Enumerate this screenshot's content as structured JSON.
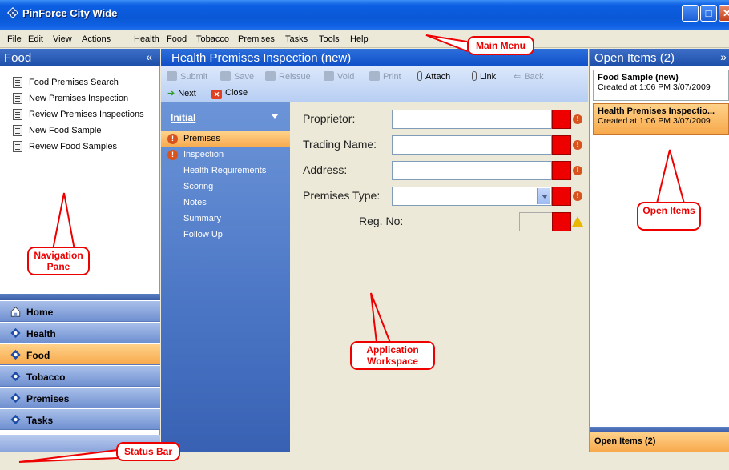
{
  "window": {
    "title": "PinForce City Wide"
  },
  "menu": {
    "items": [
      "File",
      "Edit",
      "View",
      "Actions",
      "Health",
      "Food",
      "Tobacco",
      "Premises",
      "Tasks",
      "Tools",
      "Help"
    ]
  },
  "nav_pane": {
    "title": "Food",
    "links": [
      "Food Premises Search",
      "New Premises Inspection",
      "Review Premises Inspections",
      "New Food Sample",
      "Review Food Samples"
    ],
    "buttons": [
      "Home",
      "Health",
      "Food",
      "Tobacco",
      "Premises",
      "Tasks"
    ],
    "active_button": "Food"
  },
  "workspace": {
    "title": "Health Premises Inspection (new)",
    "toolbar": {
      "submit": "Submit",
      "save": "Save",
      "reissue": "Reissue",
      "void": "Void",
      "print": "Print",
      "attach": "Attach",
      "link": "Link",
      "back": "Back",
      "next": "Next",
      "close": "Close"
    },
    "steps_header": "Initial",
    "steps": [
      "Premises",
      "Inspection",
      "Health Requirements",
      "Scoring",
      "Notes",
      "Summary",
      "Follow Up"
    ],
    "active_step": "Premises",
    "form": {
      "proprietor_label": "Proprietor:",
      "trading_name_label": "Trading Name:",
      "address_label": "Address:",
      "premises_type_label": "Premises Type:",
      "reg_no_label": "Reg. No:",
      "proprietor_value": "",
      "trading_name_value": "",
      "address_value": "",
      "premises_type_value": "",
      "reg_no_value": ""
    }
  },
  "open_items": {
    "title": "Open Items (2)",
    "items": [
      {
        "name": "Food Sample (new)",
        "created": "Created at 1:06 PM 3/07/2009"
      },
      {
        "name": "Health Premises Inspectio...",
        "created": "Created at 1:06 PM 3/07/2009"
      }
    ],
    "footer": "Open Items (2)"
  },
  "callouts": {
    "main_menu": "Main Menu",
    "navigation_pane": "Navigation Pane",
    "application_workspace": "Application Workspace",
    "open_items": "Open Items",
    "status_bar": "Status Bar"
  },
  "colors": {
    "accent": "#f7a94c",
    "title_blue": "#0f4fc8",
    "required_red": "#ee0000",
    "callout_red": "#e00000"
  }
}
